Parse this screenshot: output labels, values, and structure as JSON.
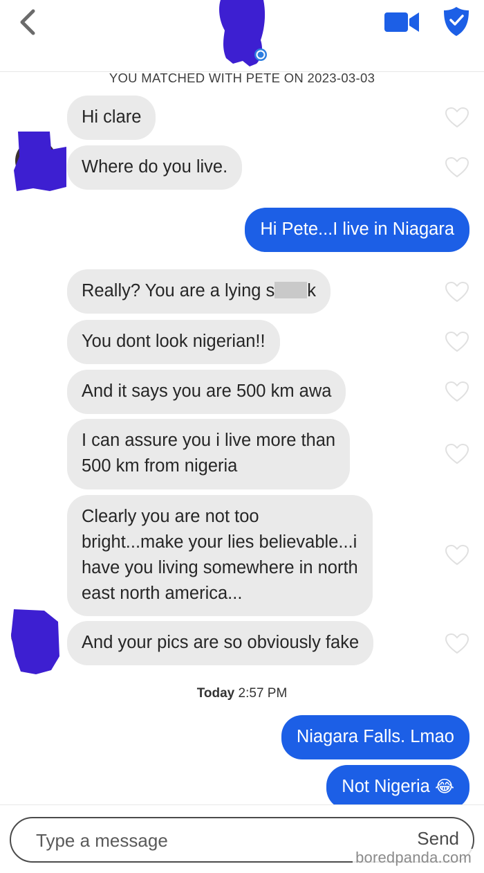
{
  "header": {
    "match_text": "YOU MATCHED WITH PETE ON 2023-03-03",
    "icons": {
      "back": "chevron-left-icon",
      "video": "video-camera-icon",
      "safety": "shield-icon",
      "verified": "verified-badge-icon"
    },
    "accent_color": "#1c5fe6"
  },
  "messages": [
    {
      "dir": "in",
      "text": "Hi clare"
    },
    {
      "dir": "in",
      "text": "Where do you live."
    },
    {
      "dir": "out",
      "text": "Hi Pete...I live in Niagara"
    },
    {
      "dir": "in",
      "text_before": "Really? You are a lying s",
      "text_after": "k",
      "censored": true
    },
    {
      "dir": "in",
      "text": "You dont look nigerian!!"
    },
    {
      "dir": "in",
      "text": "And it says you are 500 km awa"
    },
    {
      "dir": "in",
      "text": "I can assure you i live more than\n500 km from nigeria"
    },
    {
      "dir": "in",
      "text": "Clearly you are not too\nbright...make your lies believable...i\nhave you living somewhere in north\neast north america..."
    },
    {
      "dir": "in",
      "text": "And your pics are so obviously fake"
    },
    {
      "dir": "out",
      "text": "Niagara Falls. Lmao"
    },
    {
      "dir": "out",
      "text": "Not Nigeria",
      "emoji": "😂"
    }
  ],
  "timestamp": {
    "day": "Today",
    "time": "2:57 PM"
  },
  "composer": {
    "placeholder": "Type a message",
    "send_label": "Send"
  },
  "watermark": "boredpanda.com"
}
